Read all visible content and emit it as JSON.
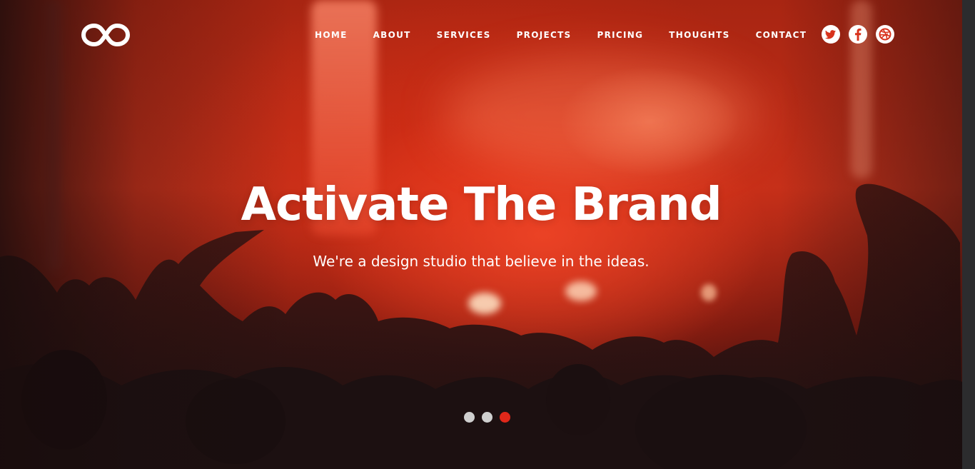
{
  "brand": {
    "logo_icon": "infinity-logo-icon"
  },
  "nav": {
    "items": [
      {
        "label": "HOME"
      },
      {
        "label": "ABOUT"
      },
      {
        "label": "SERVICES"
      },
      {
        "label": "PROJECTS"
      },
      {
        "label": "PRICING"
      },
      {
        "label": "THOUGHTS"
      },
      {
        "label": "CONTACT"
      }
    ]
  },
  "social": {
    "items": [
      {
        "icon": "twitter-bird-icon"
      },
      {
        "icon": "facebook-icon"
      },
      {
        "icon": "dribbble-icon"
      }
    ],
    "icon_color": "#d8321c"
  },
  "hero": {
    "title": "Activate The Brand",
    "subtitle": "We're a design studio that believe in the ideas."
  },
  "slider": {
    "total_slides": 3,
    "active_index": 2,
    "active_color": "#e0281a",
    "inactive_color": "#cfcfcf"
  },
  "colors": {
    "accent": "#e0281a",
    "text": "#ffffff"
  }
}
